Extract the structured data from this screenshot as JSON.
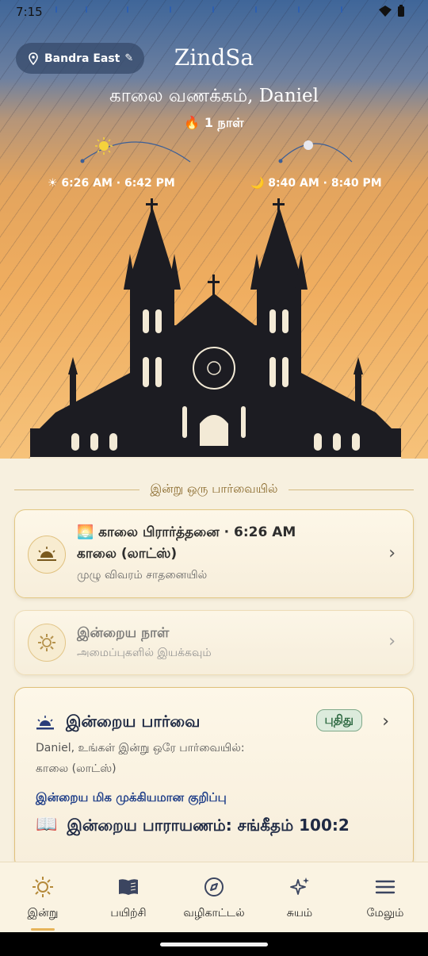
{
  "status_bar": {
    "time": "7:15"
  },
  "header": {
    "location": "Bandra East",
    "brand": "ZindSa",
    "greeting": "காலை வணக்கம், Daniel",
    "streak": "🔥 1 நாள்",
    "sun_times": "☀ 6:26 AM · 6:42 PM",
    "moon_times": "🌙 8:40 AM · 8:40 PM"
  },
  "section_title": "இன்று ஒரு பார்வையில்",
  "prayer_card": {
    "line1": "🌅 காலை பிரார்த்தனை · 6:26 AM",
    "line2": "காலை (லாட்ஸ்)",
    "line3": "முழு விவரம் சாதனையில்"
  },
  "day_card": {
    "title": "இன்றைய நாள்",
    "subtitle": "அமைப்புகளில் இயக்கவும்"
  },
  "overview_card": {
    "title": "இன்றைய பார்வை",
    "badge": "புதிது",
    "line1": "Daniel, உங்கள் இன்று ஒரே பார்வையில்:",
    "line2": "காலை (லாட்ஸ்)",
    "highlight": "இன்றைய மிக முக்கியமான குறிப்பு",
    "reading": "இன்றைய பாராயணம்: சங்கீதம் 100:2"
  },
  "nav": [
    {
      "label": "இன்று",
      "icon": "sun-icon",
      "active": true
    },
    {
      "label": "பயிற்சி",
      "icon": "book-icon",
      "active": false
    },
    {
      "label": "வழிகாட்டல்",
      "icon": "compass-icon",
      "active": false
    },
    {
      "label": "சுயம்",
      "icon": "sparkles-icon",
      "active": false
    },
    {
      "label": "மேலும்",
      "icon": "menu-icon",
      "active": false
    }
  ],
  "colors": {
    "accent": "#e7b45a",
    "link_blue": "#1f3e88",
    "badge_green": "#2f6a43"
  }
}
